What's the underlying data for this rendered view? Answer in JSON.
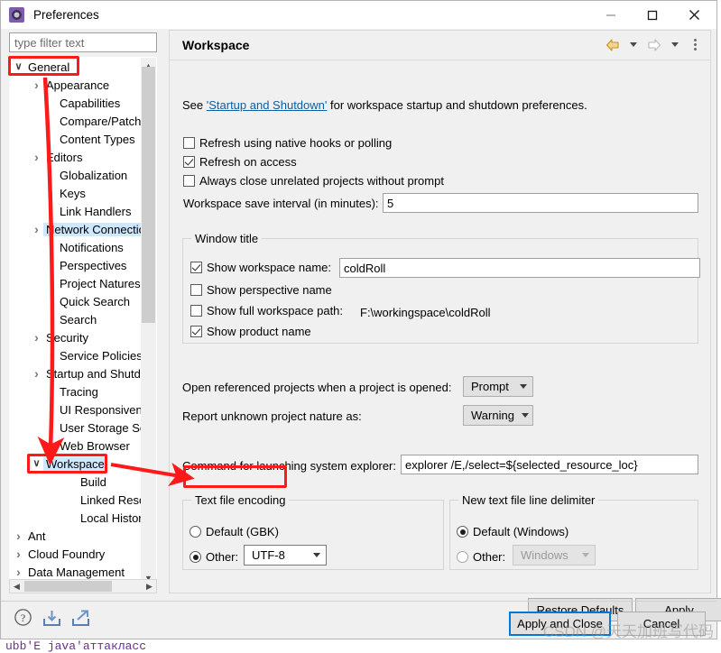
{
  "window": {
    "title": "Preferences",
    "icon": "preferences-gear-icon",
    "controls": {
      "minimize": "—",
      "maximize": "☐",
      "close": "✕"
    }
  },
  "sidebar": {
    "filter_placeholder": "type filter text",
    "filter_value": "",
    "tree": [
      {
        "label": "General",
        "level": 0,
        "expanded": true,
        "arrow": "chevron-down",
        "selected": false,
        "highlight": false
      },
      {
        "label": "Appearance",
        "level": 1,
        "arrow": "chevron-right"
      },
      {
        "label": "Capabilities",
        "level": 1,
        "arrow": ""
      },
      {
        "label": "Compare/Patch",
        "level": 1,
        "arrow": ""
      },
      {
        "label": "Content Types",
        "level": 1,
        "arrow": ""
      },
      {
        "label": "Editors",
        "level": 1,
        "arrow": "chevron-right"
      },
      {
        "label": "Globalization",
        "level": 1,
        "arrow": ""
      },
      {
        "label": "Keys",
        "level": 1,
        "arrow": ""
      },
      {
        "label": "Link Handlers",
        "level": 1,
        "arrow": ""
      },
      {
        "label": "Network Connectio",
        "level": 1,
        "arrow": "chevron-right",
        "highlight": true
      },
      {
        "label": "Notifications",
        "level": 1,
        "arrow": ""
      },
      {
        "label": "Perspectives",
        "level": 1,
        "arrow": ""
      },
      {
        "label": "Project Natures",
        "level": 1,
        "arrow": ""
      },
      {
        "label": "Quick Search",
        "level": 1,
        "arrow": ""
      },
      {
        "label": "Search",
        "level": 1,
        "arrow": ""
      },
      {
        "label": "Security",
        "level": 1,
        "arrow": "chevron-right"
      },
      {
        "label": "Service Policies",
        "level": 1,
        "arrow": ""
      },
      {
        "label": "Startup and Shutdo",
        "level": 1,
        "arrow": "chevron-right"
      },
      {
        "label": "Tracing",
        "level": 1,
        "arrow": ""
      },
      {
        "label": "UI Responsiveness",
        "level": 1,
        "arrow": ""
      },
      {
        "label": "User Storage Servic",
        "level": 1,
        "arrow": ""
      },
      {
        "label": "Web Browser",
        "level": 1,
        "arrow": ""
      },
      {
        "label": "Workspace",
        "level": 1,
        "arrow": "chevron-down",
        "selected": true,
        "highlight": true
      },
      {
        "label": "Build",
        "level": 2,
        "arrow": ""
      },
      {
        "label": "Linked Resource",
        "level": 2,
        "arrow": ""
      },
      {
        "label": "Local History",
        "level": 2,
        "arrow": ""
      },
      {
        "label": "Ant",
        "level": 0,
        "arrow": "chevron-right"
      },
      {
        "label": "Cloud Foundry",
        "level": 0,
        "arrow": "chevron-right"
      },
      {
        "label": "Data Management",
        "level": 0,
        "arrow": "chevron-right"
      }
    ]
  },
  "panel": {
    "title": "Workspace",
    "toolbar": {
      "back": "back-arrow-icon",
      "back_menu": "back-dropdown-icon",
      "forward": "forward-arrow-icon",
      "forward_menu": "forward-dropdown-icon",
      "menu": "view-menu-icon"
    },
    "intro": {
      "prefix": "See ",
      "link": "'Startup and Shutdown'",
      "suffix": " for workspace startup and shutdown preferences."
    },
    "checkboxes": [
      {
        "label": "Refresh using native hooks or polling",
        "checked": false,
        "mnemonic": "R"
      },
      {
        "label": "Refresh on access",
        "checked": true,
        "mnemonic": "s"
      },
      {
        "label": "Always close unrelated projects without prompt",
        "checked": false,
        "mnemonic": "c"
      }
    ],
    "save_interval": {
      "label": "Workspace save interval (in minutes):",
      "value": "5"
    },
    "window_title_group": {
      "label": "Window title",
      "show_workspace_name": {
        "label": "Show workspace name:",
        "checked": true,
        "value": "coldRoll"
      },
      "show_perspective_name": {
        "label": "Show perspective name",
        "checked": false
      },
      "show_full_workspace_path": {
        "label": "Show full workspace path:",
        "checked": false,
        "value": "F:\\workingspace\\coldRoll"
      },
      "show_product_name": {
        "label": "Show product name",
        "checked": true
      }
    },
    "open_referenced": {
      "label": "Open referenced projects when a project is opened:",
      "value": "Prompt"
    },
    "report_nature": {
      "label": "Report unknown project nature as:",
      "value": "Warning"
    },
    "explorer_command": {
      "label": "Command for launching system explorer:",
      "value": "explorer /E,/select=${selected_resource_loc}"
    },
    "text_file_encoding": {
      "label": "Text file encoding",
      "default_option": {
        "label": "Default (GBK)",
        "selected": false
      },
      "other_option": {
        "label": "Other:",
        "selected": true,
        "value": "UTF-8"
      }
    },
    "line_delimiter": {
      "label": "New text file line delimiter",
      "default_option": {
        "label": "Default (Windows)",
        "selected": true
      },
      "other_option": {
        "label": "Other:",
        "selected": false,
        "value": "Windows",
        "disabled": true
      }
    },
    "buttons": {
      "restore_defaults": "Restore Defaults",
      "apply": "Apply"
    }
  },
  "footer": {
    "help_icon": "help-question-icon",
    "import_icon": "import-icon",
    "export_icon": "export-icon",
    "apply_and_close": "Apply and Close",
    "cancel": "Cancel"
  },
  "overlay": {
    "watermark": "CSDN @天天加班写代码",
    "behind_text": "ubb'E  java'аттакласс"
  },
  "colors": {
    "accent_focus": "#0078d7",
    "annotation_red": "#ff1a1a",
    "tree_highlight": "#cde8ff",
    "link": "#0b61a4",
    "back_arrow": "#e8a317",
    "panel_bg": "#f0f0f0"
  }
}
